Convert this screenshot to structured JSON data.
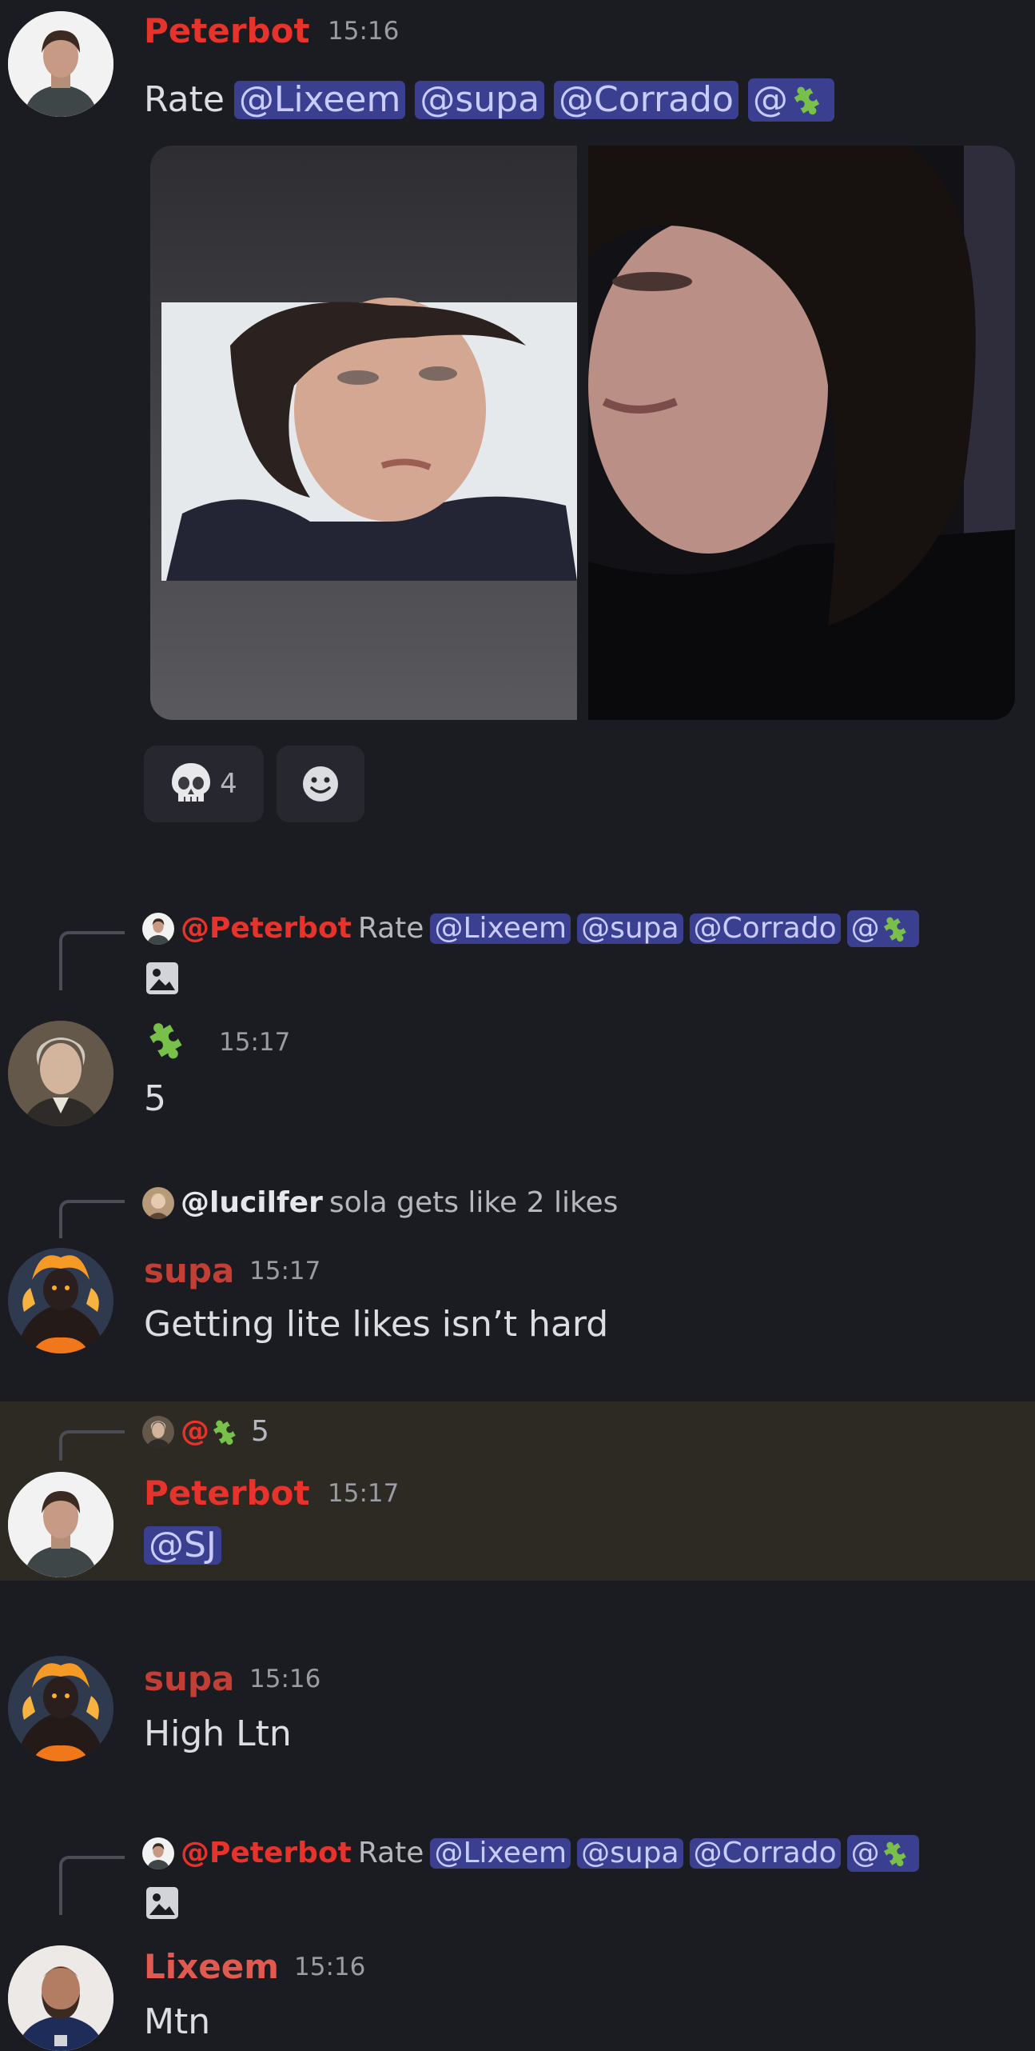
{
  "messages": [
    {
      "author": "Peterbot",
      "time": "15:16",
      "content_prefix": "Rate",
      "mentions": [
        "@Lixeem",
        "@supa",
        "@Corrado",
        "@"
      ],
      "reactions": [
        {
          "emoji_icon": "skull-icon",
          "count": "4"
        },
        {
          "emoji_icon": "add-reaction-icon",
          "count": ""
        }
      ]
    },
    {
      "reply": {
        "author": "@Peterbot",
        "text": "Rate",
        "mentions": [
          "@Lixeem",
          "@supa",
          "@Corrado",
          "@"
        ],
        "attachment_icon": "image-icon"
      },
      "author_icon": "puzzle-icon",
      "time": "15:17",
      "content": "5"
    },
    {
      "reply": {
        "author": "@lucilfer",
        "text": "sola gets like 2 likes"
      },
      "author": "supa",
      "time": "15:17",
      "content": "Getting lite likes isn’t hard"
    },
    {
      "reply": {
        "author": "@",
        "text": "5"
      },
      "author": "Peterbot",
      "time": "15:17",
      "content_mention": "@SJ"
    },
    {
      "author": "supa",
      "time": "15:16",
      "content": "High Ltn"
    },
    {
      "reply": {
        "author": "@Peterbot",
        "text": "Rate",
        "mentions": [
          "@Lixeem",
          "@supa",
          "@Corrado",
          "@"
        ],
        "attachment_icon": "image-icon"
      },
      "author": "Lixeem",
      "time": "15:16",
      "content": "Mtn"
    }
  ],
  "colors": {
    "background": "#1b1c21",
    "mention_bg": "#3b3f8f",
    "peterbot_name": "#e8332c",
    "highlight_bg": "#2c2a23"
  }
}
